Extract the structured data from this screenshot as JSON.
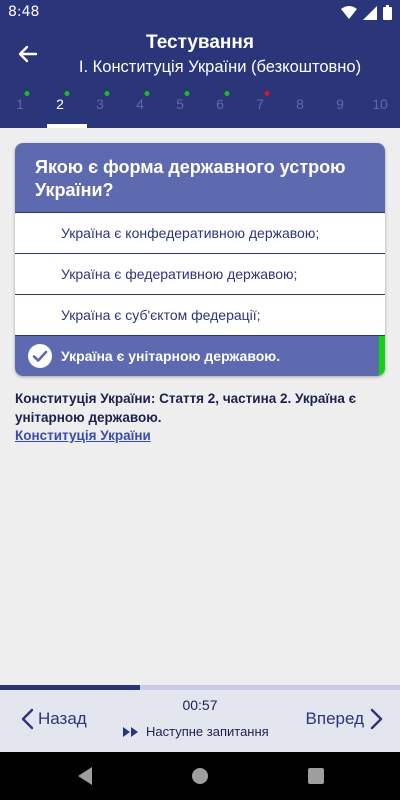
{
  "status_bar": {
    "time": "8:48"
  },
  "header": {
    "title": "Тестування",
    "subtitle": "I. Конституція України (безкоштовно)"
  },
  "question_tabs": [
    {
      "label": "1",
      "dot": "green",
      "active": false
    },
    {
      "label": "2",
      "dot": "green",
      "active": true
    },
    {
      "label": "3",
      "dot": "green",
      "active": false
    },
    {
      "label": "4",
      "dot": "green",
      "active": false
    },
    {
      "label": "5",
      "dot": "green",
      "active": false
    },
    {
      "label": "6",
      "dot": "green",
      "active": false
    },
    {
      "label": "7",
      "dot": "red",
      "active": false
    },
    {
      "label": "8",
      "dot": "none",
      "active": false
    },
    {
      "label": "9",
      "dot": "none",
      "active": false
    },
    {
      "label": "10",
      "dot": "none",
      "active": false
    }
  ],
  "question": {
    "text": "Якою є форма державного устрою України?",
    "options": [
      {
        "text": "Україна є конфедеративною державою;",
        "correct": false
      },
      {
        "text": "Україна є федеративною державою;",
        "correct": false
      },
      {
        "text": "Україна є суб'єктом федерації;",
        "correct": false
      },
      {
        "text": "Україна є унітарною державою.",
        "correct": true
      }
    ]
  },
  "explanation": {
    "text": "Конституція України: Стаття 2, частина 2. Україна є унітарною державою.",
    "link": "Конституція України"
  },
  "progress": {
    "fraction": 0.35
  },
  "footer": {
    "prev_label": "Назад",
    "next_label": "Вперед",
    "timer": "00:57",
    "skip_label": "Наступне запитання"
  },
  "colors": {
    "primary": "#2b357a",
    "accent": "#5d6ab0",
    "correct": "#12d312",
    "dot_green": "#16c316",
    "dot_red": "#d11a1a"
  }
}
